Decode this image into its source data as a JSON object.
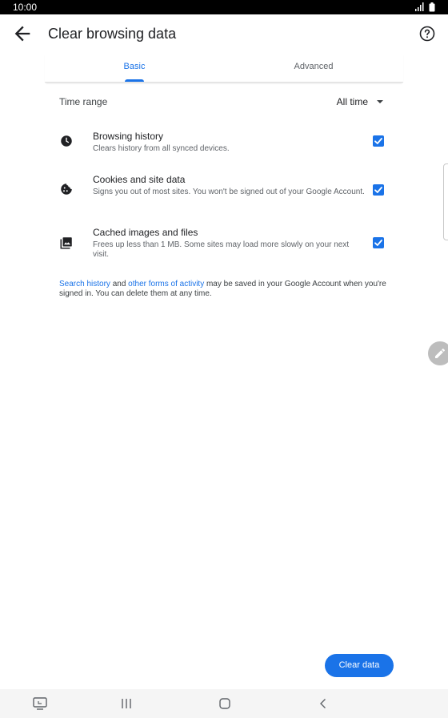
{
  "status_bar": {
    "time": "10:00",
    "icons": [
      "signal-icon",
      "battery-icon"
    ]
  },
  "app_bar": {
    "title": "Clear browsing data",
    "back_icon": "arrow-left-icon",
    "help_icon": "help-circle-icon"
  },
  "tabs": [
    {
      "label": "Basic",
      "selected": true
    },
    {
      "label": "Advanced",
      "selected": false
    }
  ],
  "time_range": {
    "label": "Time range",
    "value": "All time"
  },
  "options": [
    {
      "title": "Browsing history",
      "description": "Clears history from all synced devices.",
      "icon": "clock-icon",
      "checked": true
    },
    {
      "title": "Cookies and site data",
      "description": "Signs you out of most sites. You won't be signed out of your Google Account.",
      "icon": "cookie-icon",
      "checked": true
    },
    {
      "title": "Cached images and files",
      "description": "Frees up less than 1 MB. Some sites may load more slowly on your next visit.",
      "icon": "image-icon",
      "checked": true
    }
  ],
  "note": {
    "link1": "Search history",
    "text1": " and ",
    "link2": "other forms of activity",
    "text2": " may be saved in your Google Account when you're signed in. You can delete them at any time."
  },
  "actions": {
    "clear_label": "Clear data"
  },
  "nav_bar": {
    "items": [
      "recent-apps-icon",
      "home-icon",
      "back-icon"
    ]
  },
  "colors": {
    "accent": "#1a73e8",
    "text_primary": "#202124",
    "text_secondary": "#5f6368"
  }
}
